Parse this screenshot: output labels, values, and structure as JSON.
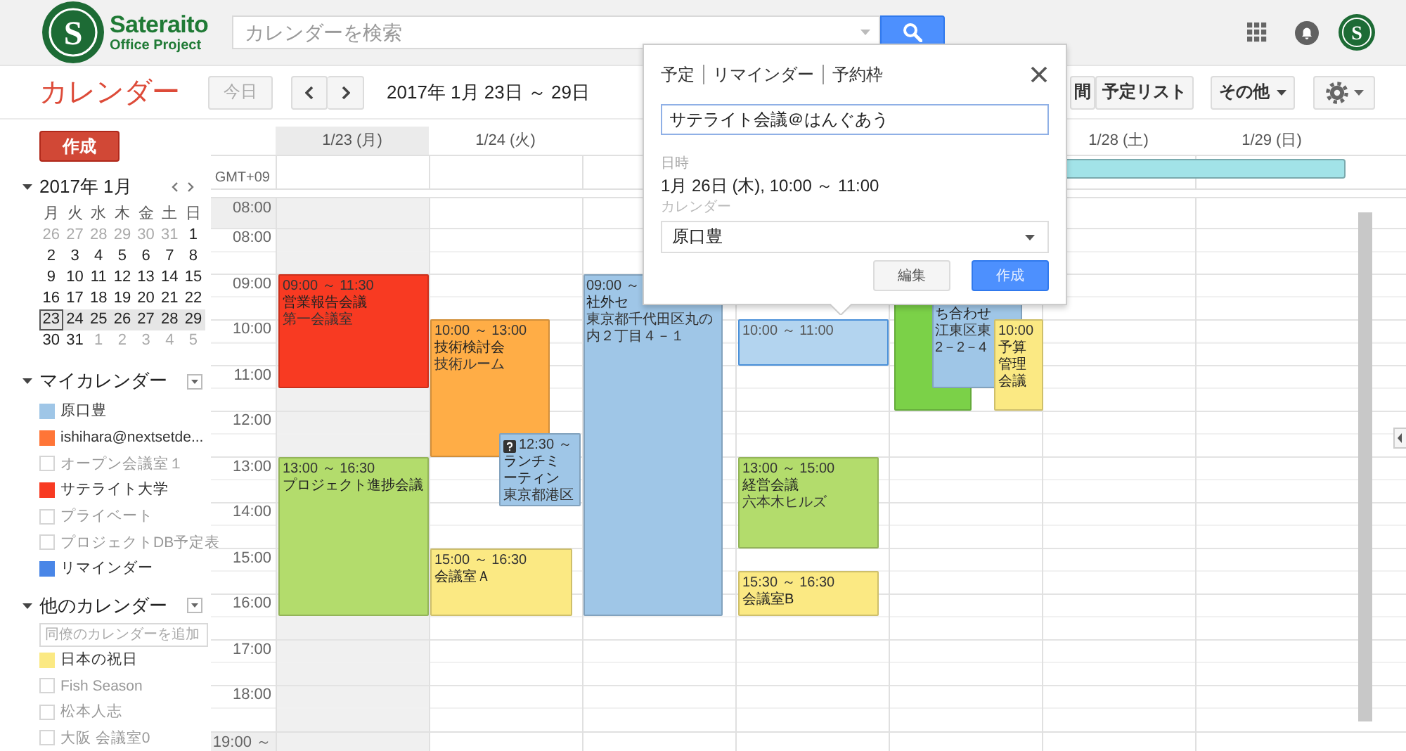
{
  "header": {
    "logo": {
      "mark": "S",
      "name": "Sateraito",
      "tagline": "Office Project"
    },
    "search": {
      "placeholder": "カレンダーを検索"
    },
    "avatar": "S"
  },
  "toolbar": {
    "title": "カレンダー",
    "today_button": {
      "label": "今日",
      "disabled": true
    },
    "range": "2017年 1月 23日 ～ 29日",
    "views": [
      "間",
      "予定リスト"
    ],
    "more_button": "その他"
  },
  "sidebar": {
    "create_button": "作成",
    "mini_calendar": {
      "title": "2017年 1月",
      "weekdays": [
        "月",
        "火",
        "水",
        "木",
        "金",
        "土",
        "日"
      ],
      "weeks": [
        {
          "selected": false,
          "days": [
            {
              "label": "26",
              "outside": true,
              "today": false
            },
            {
              "label": "27",
              "outside": true,
              "today": false
            },
            {
              "label": "28",
              "outside": true,
              "today": false
            },
            {
              "label": "29",
              "outside": true,
              "today": false
            },
            {
              "label": "30",
              "outside": true,
              "today": false
            },
            {
              "label": "31",
              "outside": true,
              "today": false
            },
            {
              "label": "1",
              "outside": false,
              "today": false
            }
          ]
        },
        {
          "selected": false,
          "days": [
            {
              "label": "2",
              "outside": false,
              "today": false
            },
            {
              "label": "3",
              "outside": false,
              "today": false
            },
            {
              "label": "4",
              "outside": false,
              "today": false
            },
            {
              "label": "5",
              "outside": false,
              "today": false
            },
            {
              "label": "6",
              "outside": false,
              "today": false
            },
            {
              "label": "7",
              "outside": false,
              "today": false
            },
            {
              "label": "8",
              "outside": false,
              "today": false
            }
          ]
        },
        {
          "selected": false,
          "days": [
            {
              "label": "9",
              "outside": false,
              "today": false
            },
            {
              "label": "10",
              "outside": false,
              "today": false
            },
            {
              "label": "11",
              "outside": false,
              "today": false
            },
            {
              "label": "12",
              "outside": false,
              "today": false
            },
            {
              "label": "13",
              "outside": false,
              "today": false
            },
            {
              "label": "14",
              "outside": false,
              "today": false
            },
            {
              "label": "15",
              "outside": false,
              "today": false
            }
          ]
        },
        {
          "selected": false,
          "days": [
            {
              "label": "16",
              "outside": false,
              "today": false
            },
            {
              "label": "17",
              "outside": false,
              "today": false
            },
            {
              "label": "18",
              "outside": false,
              "today": false
            },
            {
              "label": "19",
              "outside": false,
              "today": false
            },
            {
              "label": "20",
              "outside": false,
              "today": false
            },
            {
              "label": "21",
              "outside": false,
              "today": false
            },
            {
              "label": "22",
              "outside": false,
              "today": false
            }
          ]
        },
        {
          "selected": true,
          "days": [
            {
              "label": "23",
              "outside": false,
              "today": true
            },
            {
              "label": "24",
              "outside": false,
              "today": false
            },
            {
              "label": "25",
              "outside": false,
              "today": false
            },
            {
              "label": "26",
              "outside": false,
              "today": false
            },
            {
              "label": "27",
              "outside": false,
              "today": false
            },
            {
              "label": "28",
              "outside": false,
              "today": false
            },
            {
              "label": "29",
              "outside": false,
              "today": false
            }
          ]
        },
        {
          "selected": false,
          "days": [
            {
              "label": "30",
              "outside": false,
              "today": false
            },
            {
              "label": "31",
              "outside": false,
              "today": false
            },
            {
              "label": "1",
              "outside": true,
              "today": false
            },
            {
              "label": "2",
              "outside": true,
              "today": false
            },
            {
              "label": "3",
              "outside": true,
              "today": false
            },
            {
              "label": "4",
              "outside": true,
              "today": false
            },
            {
              "label": "5",
              "outside": true,
              "today": false
            }
          ]
        }
      ]
    },
    "my_calendars": {
      "title": "マイカレンダー",
      "items": [
        {
          "label": "原口豊",
          "visible": true,
          "color": "#9fc6e7"
        },
        {
          "label": "ishihara@nextsetde...",
          "visible": true,
          "color": "#ff7537"
        },
        {
          "label": "オープン会議室１",
          "visible": false
        },
        {
          "label": "サテライト大学",
          "visible": true,
          "color": "#f83a22"
        },
        {
          "label": "プライベート",
          "visible": false
        },
        {
          "label": "プロジェクトDB予定表",
          "visible": false
        },
        {
          "label": "リマインダー",
          "visible": true,
          "color": "#4986e7"
        }
      ]
    },
    "other_calendars": {
      "title": "他のカレンダー",
      "add_field": {
        "placeholder": "同僚のカレンダーを追加"
      },
      "items": [
        {
          "label": "日本の祝日",
          "visible": true,
          "color": "#fbe983"
        },
        {
          "label": "Fish Season",
          "visible": false
        },
        {
          "label": "松本人志",
          "visible": false
        },
        {
          "label": "大阪 会議室0",
          "visible": false
        }
      ]
    }
  },
  "grid": {
    "timezone": "GMT+09",
    "days": [
      {
        "label": "1/23 (月)",
        "today": true,
        "events": [
          {
            "kind": "event",
            "color": "#f83a22",
            "time": "09:00 ～ 11:30",
            "title": "営業報告会議",
            "details": [
              "第一会議室"
            ]
          },
          {
            "kind": "event",
            "color": "#b3dc6c",
            "time": "13:00 ～ 16:30",
            "title": "プロジェクト進捗会議"
          }
        ]
      },
      {
        "label": "1/24 (火)",
        "today": false,
        "events": [
          {
            "kind": "event",
            "color": "#ffad46",
            "time": "10:00 ～ 13:00",
            "title": "技術検討会",
            "details": [
              "技術ルーム"
            ]
          },
          {
            "kind": "invitation",
            "color": "#9fc6e7",
            "time": "12:30 ～",
            "title": "ランチミーティン",
            "details": [
              "東京都港区"
            ]
          },
          {
            "kind": "event",
            "color": "#fbe983",
            "time": "15:00 ～ 16:30",
            "title": "会議室Ａ"
          }
        ]
      },
      {
        "events": [
          {
            "kind": "event",
            "color": "#9fc6e7",
            "time": "09:00 ～",
            "title": "社外セ",
            "details": [
              "東京都千代田区丸の内２丁目４－１"
            ]
          }
        ]
      },
      {
        "events": [
          {
            "kind": "draft",
            "color": "#b3d4ef",
            "time": "10:00 ～ 11:00"
          },
          {
            "kind": "event",
            "color": "#b3dc6c",
            "time": "13:00 ～ 15:00",
            "title": "経営会議",
            "details": [
              "六本木ヒルズ"
            ]
          },
          {
            "kind": "event",
            "color": "#fbe983",
            "time": "15:30 ～ 16:30",
            "title": "会議室B"
          }
        ]
      },
      {
        "events": [
          {
            "kind": "event",
            "color": "#7bd148"
          },
          {
            "kind": "event",
            "color": "#9fc6e7",
            "title": "ち合わせ",
            "details": [
              "江東区東",
              "2－2－4"
            ]
          },
          {
            "kind": "event",
            "color": "#fbe983",
            "time": "10:00",
            "title": "予算管理会議"
          }
        ]
      },
      {
        "label": "1/28 (土)",
        "today": false
      },
      {
        "label": "1/29 (日)",
        "today": false
      }
    ],
    "all_day": [
      {
        "color": "#a2e3e8"
      }
    ],
    "times": [
      {
        "label": "08:00",
        "kind": "collapsed"
      },
      {
        "label": "08:00",
        "kind": "hour"
      },
      {
        "label": "09:00",
        "kind": "hour"
      },
      {
        "label": "10:00",
        "kind": "hour"
      },
      {
        "label": "11:00",
        "kind": "hour"
      },
      {
        "label": "12:00",
        "kind": "hour"
      },
      {
        "label": "13:00",
        "kind": "hour"
      },
      {
        "label": "14:00",
        "kind": "hour"
      },
      {
        "label": "15:00",
        "kind": "hour"
      },
      {
        "label": "16:00",
        "kind": "hour"
      },
      {
        "label": "17:00",
        "kind": "hour"
      },
      {
        "label": "18:00",
        "kind": "hour"
      },
      {
        "label": "19:00 ～",
        "kind": "collapsed"
      }
    ]
  },
  "popup": {
    "tabs": [
      "予定",
      "リマインダー",
      "予約枠"
    ],
    "title_value": "サテライト会議＠はんぐあう",
    "when_label": "日時",
    "when": "1月 26日 (木), 10:00 ～ 11:00",
    "calendar_label": "カレンダー",
    "calendar_value": "原口豊",
    "buttons": [
      {
        "label": "編集",
        "kind": "secondary"
      },
      {
        "label": "作成",
        "kind": "primary"
      }
    ]
  }
}
